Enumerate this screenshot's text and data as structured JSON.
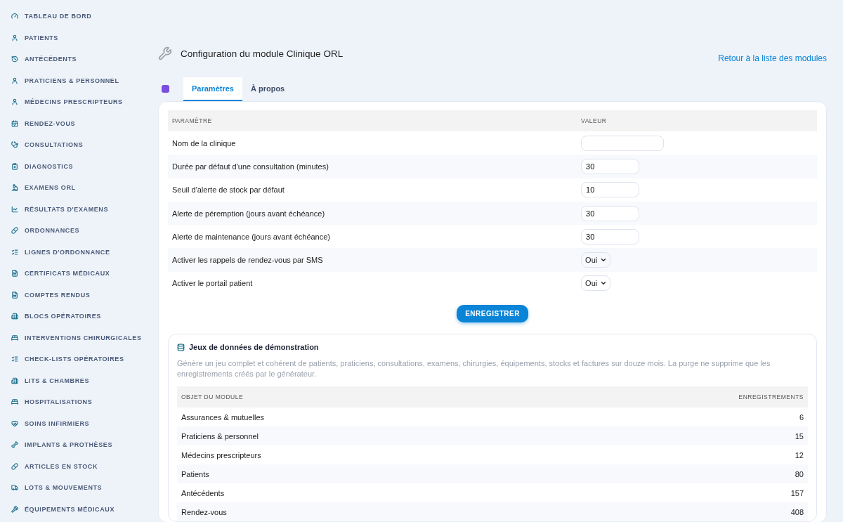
{
  "sidebar": {
    "items": [
      {
        "label": "TABLEAU DE BORD"
      },
      {
        "label": "PATIENTS"
      },
      {
        "label": "ANTÉCÉDENTS"
      },
      {
        "label": "PRATICIENS & PERSONNEL"
      },
      {
        "label": "MÉDECINS PRESCRIPTEURS"
      },
      {
        "label": "RENDEZ-VOUS"
      },
      {
        "label": "CONSULTATIONS"
      },
      {
        "label": "DIAGNOSTICS"
      },
      {
        "label": "EXAMENS ORL"
      },
      {
        "label": "RÉSULTATS D'EXAMENS"
      },
      {
        "label": "ORDONNANCES"
      },
      {
        "label": "LIGNES D'ORDONNANCE"
      },
      {
        "label": "CERTIFICATS MÉDICAUX"
      },
      {
        "label": "COMPTES RENDUS"
      },
      {
        "label": "BLOCS OPÉRATOIRES"
      },
      {
        "label": "INTERVENTIONS CHIRURGICALES"
      },
      {
        "label": "CHECK-LISTS OPÉRATOIRES"
      },
      {
        "label": "LITS & CHAMBRES"
      },
      {
        "label": "HOSPITALISATIONS"
      },
      {
        "label": "SOINS INFIRMIERS"
      },
      {
        "label": "IMPLANTS & PROTHÈSES"
      },
      {
        "label": "ARTICLES EN STOCK"
      },
      {
        "label": "LOTS & MOUVEMENTS"
      },
      {
        "label": "ÉQUIPEMENTS MÉDICAUX"
      }
    ]
  },
  "header": {
    "title": "Configuration du module Clinique ORL",
    "back_link": "Retour à la liste des modules"
  },
  "tabs": [
    {
      "label": "Paramètres",
      "selected": true
    },
    {
      "label": "À propos",
      "selected": false
    }
  ],
  "settings": {
    "columns": [
      "PARAMÈTRE",
      "VALEUR"
    ],
    "rows": [
      {
        "label": "Nom de la clinique",
        "kind": "text",
        "value": ""
      },
      {
        "label": "Durée par défaut d'une consultation (minutes)",
        "kind": "number",
        "value": "30"
      },
      {
        "label": "Seuil d'alerte de stock par défaut",
        "kind": "number",
        "value": "10"
      },
      {
        "label": "Alerte de péremption (jours avant échéance)",
        "kind": "number",
        "value": "30"
      },
      {
        "label": "Alerte de maintenance (jours avant échéance)",
        "kind": "number",
        "value": "30"
      },
      {
        "label": "Activer les rappels de rendez-vous par SMS",
        "kind": "select",
        "value": "Oui"
      },
      {
        "label": "Activer le portail patient",
        "kind": "select",
        "value": "Oui"
      }
    ],
    "save_button": "ENREGISTRER"
  },
  "demo": {
    "title": "Jeux de données de démonstration",
    "description": "Génère un jeu complet et cohérent de patients, praticiens, consultations, examens, chirurgies, équipements, stocks et factures sur douze mois. La purge ne supprime que les enregistrements créés par le générateur.",
    "columns": [
      "OBJET DU MODULE",
      "ENREGISTREMENTS"
    ],
    "rows": [
      {
        "object": "Assurances & mutuelles",
        "count": "6"
      },
      {
        "object": "Praticiens & personnel",
        "count": "15"
      },
      {
        "object": "Médecins prescripteurs",
        "count": "12"
      },
      {
        "object": "Patients",
        "count": "80"
      },
      {
        "object": "Antécédents",
        "count": "157"
      },
      {
        "object": "Rendez-vous",
        "count": "408"
      }
    ]
  }
}
